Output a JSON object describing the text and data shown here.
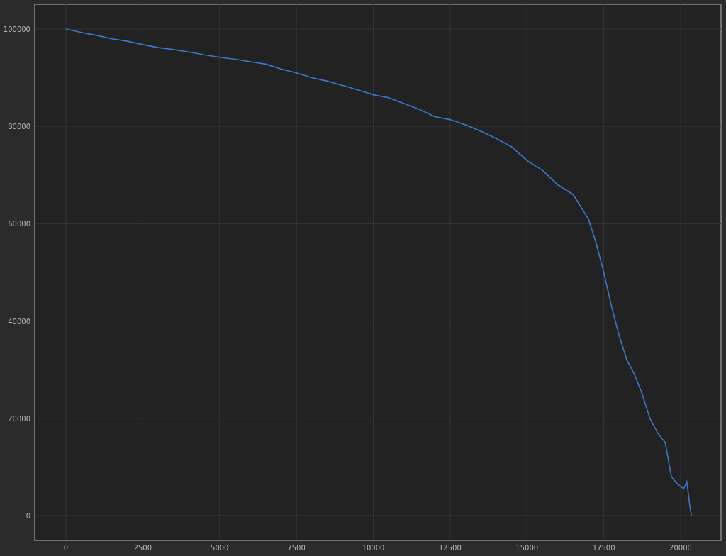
{
  "chart_data": {
    "type": "line",
    "grid": true,
    "x": [
      0,
      500,
      1000,
      1500,
      2000,
      2500,
      3000,
      3500,
      4000,
      4500,
      5000,
      5500,
      6000,
      6500,
      7000,
      7500,
      8000,
      8500,
      9000,
      9500,
      10000,
      10500,
      11000,
      11500,
      12000,
      12500,
      13000,
      13500,
      14000,
      14500,
      15000,
      15500,
      16000,
      16500,
      17000,
      17250,
      17500,
      17750,
      18000,
      18250,
      18500,
      18750,
      19000,
      19250,
      19500,
      19700,
      19900,
      20100,
      20200,
      20300,
      20350
    ],
    "series": [
      {
        "color": "#3a78d0",
        "values": [
          100000,
          99300,
          98700,
          98000,
          97500,
          96800,
          96200,
          95800,
          95300,
          94700,
          94200,
          93800,
          93300,
          92800,
          91800,
          91000,
          90000,
          89300,
          88400,
          87500,
          86500,
          85900,
          84700,
          83500,
          82000,
          81400,
          80300,
          79000,
          77500,
          75800,
          73000,
          71000,
          68000,
          66000,
          61000,
          56000,
          50000,
          43000,
          37000,
          32000,
          29000,
          25000,
          20000,
          17000,
          15000,
          8000,
          6500,
          5500,
          7000,
          2000,
          0
        ]
      }
    ],
    "xlim": [
      -1015,
      21315
    ],
    "ylim": [
      -5100,
      105100
    ],
    "xticks": [
      0,
      2500,
      5000,
      7500,
      10000,
      12500,
      15000,
      17500,
      20000
    ],
    "yticks": [
      0,
      20000,
      40000,
      60000,
      80000,
      100000
    ]
  }
}
